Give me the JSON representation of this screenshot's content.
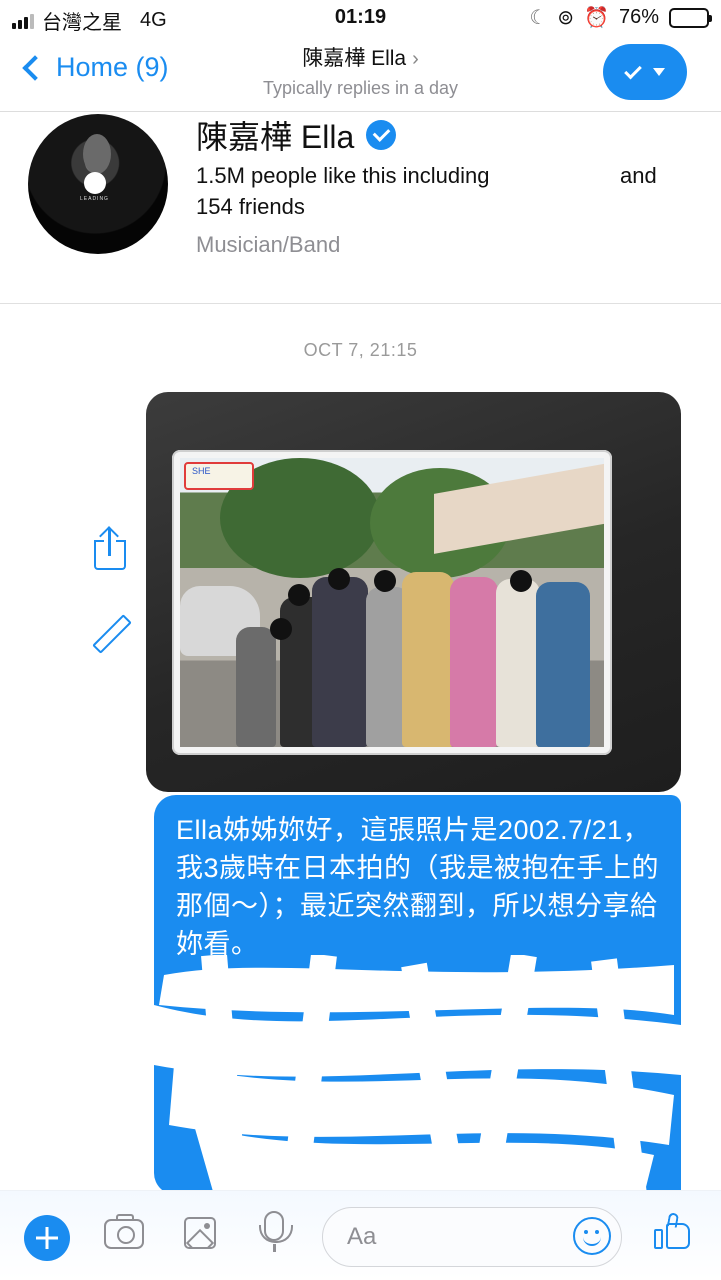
{
  "status_bar": {
    "carrier": "台灣之星",
    "network": "4G",
    "time": "01:19",
    "battery_percent": "76%",
    "battery_level": 0.76
  },
  "nav": {
    "back_label": "Home (9)",
    "title": "陳嘉樺 Ella",
    "title_arrow": "›",
    "subtitle": "Typically replies in a day"
  },
  "profile": {
    "name": "陳嘉樺 Ella",
    "likes_line": "1.5M people like this including",
    "likes_and": "and",
    "friends_line": "154 friends",
    "category": "Musician/Band",
    "avatar_caption": "LEADING"
  },
  "chat": {
    "timestamp": "OCT 7, 21:15",
    "photo_label": "SHE",
    "message": "Ella姊姊妳好，這張照片是2002.7/21，我3歲時在日本拍的（我是被抱在手上的那個～）；最近突然翻到，所以想分享給妳看。"
  },
  "composer": {
    "placeholder": "Aa"
  },
  "colors": {
    "accent": "#1a8cf0",
    "muted": "#8e8e93"
  },
  "icons": [
    "signal-icon",
    "moon-icon",
    "lock-rotation-icon",
    "alarm-icon",
    "battery-icon",
    "back-chevron-icon",
    "checkmark-icon",
    "verified-badge-icon",
    "share-icon",
    "edit-icon",
    "plus-icon",
    "camera-icon",
    "gallery-icon",
    "microphone-icon",
    "emoji-icon",
    "like-icon"
  ]
}
